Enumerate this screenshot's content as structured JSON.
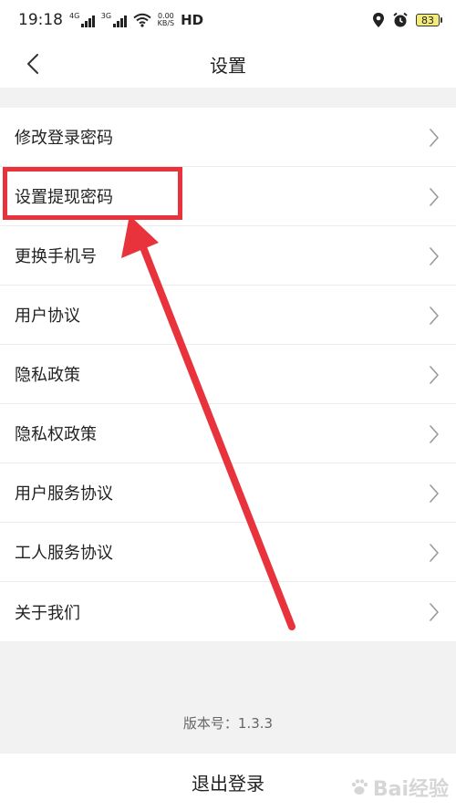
{
  "status_bar": {
    "time": "19:18",
    "net1": "4G",
    "net2": "3G",
    "speed_value": "0.00",
    "speed_unit": "KB/S",
    "hd": "HD",
    "battery": "83",
    "icons": [
      "signal-icon",
      "wifi-icon",
      "location-icon",
      "alarm-icon",
      "battery-icon"
    ]
  },
  "header": {
    "back_icon": "chevron-left-icon",
    "title": "设置"
  },
  "menu": {
    "items": [
      {
        "label": "修改登录密码"
      },
      {
        "label": "设置提现密码"
      },
      {
        "label": "更换手机号"
      },
      {
        "label": "用户协议"
      },
      {
        "label": "隐私政策"
      },
      {
        "label": "隐私权政策"
      },
      {
        "label": "用户服务协议"
      },
      {
        "label": "工人服务协议"
      },
      {
        "label": "关于我们"
      }
    ],
    "chevron_icon": "chevron-right-icon"
  },
  "footer": {
    "version": "版本号：1.3.3",
    "logout": "退出登录"
  },
  "annotation": {
    "color": "#e8333c",
    "highlighted_item": "设置提现密码"
  },
  "watermark": {
    "text": "Bai经验"
  }
}
